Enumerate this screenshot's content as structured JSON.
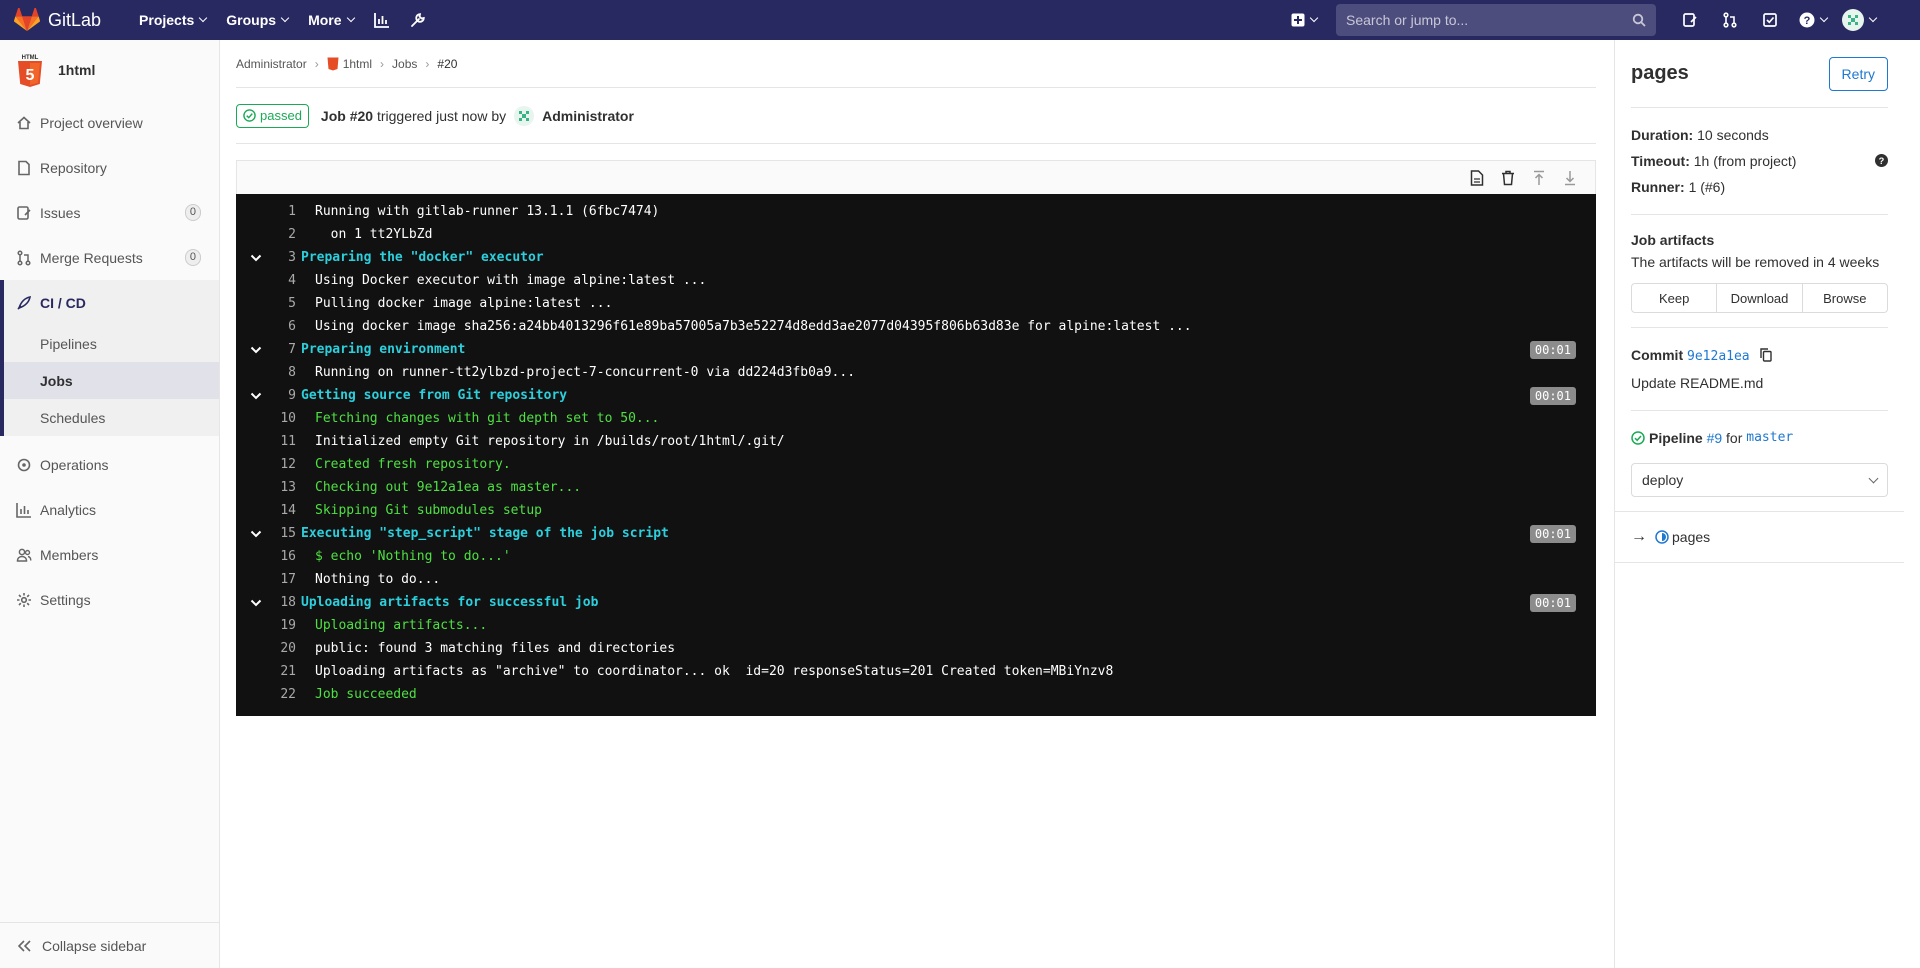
{
  "topbar": {
    "brand": "GitLab",
    "nav": [
      "Projects",
      "Groups",
      "More"
    ],
    "search_placeholder": "Search or jump to..."
  },
  "sidebar": {
    "project_name": "1html",
    "items": [
      {
        "label": "Project overview"
      },
      {
        "label": "Repository"
      },
      {
        "label": "Issues",
        "count": "0"
      },
      {
        "label": "Merge Requests",
        "count": "0"
      }
    ],
    "cicd": {
      "label": "CI / CD",
      "sub": [
        "Pipelines",
        "Jobs",
        "Schedules"
      ]
    },
    "items_after": [
      {
        "label": "Operations"
      },
      {
        "label": "Analytics"
      },
      {
        "label": "Members"
      },
      {
        "label": "Settings"
      }
    ],
    "collapse": "Collapse sidebar"
  },
  "breadcrumb": [
    "Administrator",
    "1html",
    "Jobs",
    "#20"
  ],
  "job_header": {
    "status": "passed",
    "job": "Job #20",
    "text": "triggered just now by",
    "user": "Administrator"
  },
  "log": [
    {
      "n": "1",
      "t": "Running with gitlab-runner 13.1.1 (6fbc7474)",
      "c": "white"
    },
    {
      "n": "2",
      "t": "  on 1 tt2YLbZd",
      "c": "white"
    },
    {
      "n": "3",
      "t": "Preparing the \"docker\" executor",
      "c": "cyan",
      "section": true
    },
    {
      "n": "4",
      "t": "Using Docker executor with image alpine:latest ...",
      "c": "white"
    },
    {
      "n": "5",
      "t": "Pulling docker image alpine:latest ...",
      "c": "white"
    },
    {
      "n": "6",
      "t": "Using docker image sha256:a24bb4013296f61e89ba57005a7b3e52274d8edd3ae2077d04395f806b63d83e for alpine:latest ...",
      "c": "white"
    },
    {
      "n": "7",
      "t": "Preparing environment",
      "c": "cyan",
      "section": true,
      "dur": "00:01"
    },
    {
      "n": "8",
      "t": "Running on runner-tt2ylbzd-project-7-concurrent-0 via dd224d3fb0a9...",
      "c": "white"
    },
    {
      "n": "9",
      "t": "Getting source from Git repository",
      "c": "cyan",
      "section": true,
      "dur": "00:01"
    },
    {
      "n": "10",
      "t": "Fetching changes with git depth set to 50...",
      "c": "green"
    },
    {
      "n": "11",
      "t": "Initialized empty Git repository in /builds/root/1html/.git/",
      "c": "white"
    },
    {
      "n": "12",
      "t": "Created fresh repository.",
      "c": "green"
    },
    {
      "n": "13",
      "t": "Checking out 9e12a1ea as master...",
      "c": "green"
    },
    {
      "n": "14",
      "t": "Skipping Git submodules setup",
      "c": "green"
    },
    {
      "n": "15",
      "t": "Executing \"step_script\" stage of the job script",
      "c": "cyan",
      "section": true,
      "dur": "00:01"
    },
    {
      "n": "16",
      "t": "$ echo 'Nothing to do...'",
      "c": "green"
    },
    {
      "n": "17",
      "t": "Nothing to do...",
      "c": "white"
    },
    {
      "n": "18",
      "t": "Uploading artifacts for successful job",
      "c": "cyan",
      "section": true,
      "dur": "00:01"
    },
    {
      "n": "19",
      "t": "Uploading artifacts...",
      "c": "green"
    },
    {
      "n": "20",
      "t": "public: found 3 matching files and directories",
      "c": "white"
    },
    {
      "n": "21",
      "t": "Uploading artifacts as \"archive\" to coordinator... ok  id=20 responseStatus=201 Created token=MBiYnzv8",
      "c": "white"
    },
    {
      "n": "22",
      "t": "Job succeeded",
      "c": "green"
    }
  ],
  "panel": {
    "title": "pages",
    "retry": "Retry",
    "duration_label": "Duration:",
    "duration": "10 seconds",
    "timeout_label": "Timeout:",
    "timeout": "1h (from project)",
    "runner_label": "Runner:",
    "runner": "1 (#6)",
    "artifacts_title": "Job artifacts",
    "artifacts_text": "The artifacts will be removed in 4 weeks",
    "artifact_buttons": [
      "Keep",
      "Download",
      "Browse"
    ],
    "commit_label": "Commit",
    "commit_sha": "9e12a1ea",
    "commit_msg": "Update README.md",
    "pipeline_label": "Pipeline",
    "pipeline_id": "#9",
    "pipeline_for": "for",
    "pipeline_ref": "master",
    "stage": "deploy",
    "job_item": "pages"
  },
  "colors": {
    "nav": "#292961",
    "success": "#1aaa55",
    "link": "#1f78d1"
  }
}
